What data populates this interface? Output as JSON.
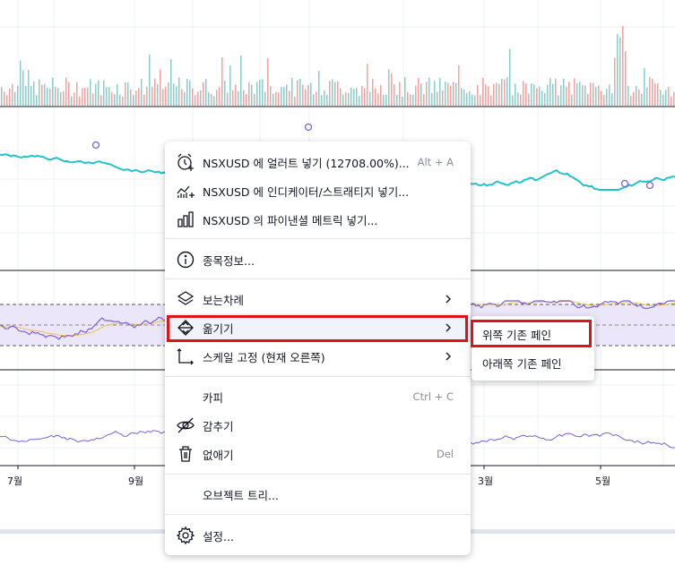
{
  "x_axis_labels": [
    "7월",
    "9월",
    "3월",
    "5월"
  ],
  "context_menu": {
    "items": [
      {
        "label": "NSXUSD 에 얼러트 넣기 (12708.00%)...",
        "shortcut": "Alt + A",
        "icon": "alarm-clock-icon"
      },
      {
        "label": "NSXUSD 에 인디케이터/스트래티지 넣기...",
        "icon": "indicator-add-icon"
      },
      {
        "label": "NSXUSD 의 파이낸셜 메트릭 넣기...",
        "icon": "bar-chart-icon"
      },
      {
        "label": "종목정보...",
        "icon": "info-icon"
      },
      {
        "label": "보는차례",
        "icon": "layers-icon",
        "has_submenu": true
      },
      {
        "label": "옮기기",
        "icon": "move-icon",
        "has_submenu": true,
        "active": true
      },
      {
        "label": "스케일 고정 (현재 오른쪽)",
        "icon": "scale-pin-icon",
        "has_submenu": true
      },
      {
        "label": "카피",
        "shortcut": "Ctrl + C"
      },
      {
        "label": "감추기",
        "icon": "eye-off-icon"
      },
      {
        "label": "없애기",
        "shortcut": "Del",
        "icon": "trash-icon"
      },
      {
        "label": "오브젝트 트리..."
      },
      {
        "label": "설정...",
        "icon": "gear-icon"
      }
    ]
  },
  "submenu": {
    "items": [
      {
        "label": "위쪽 기존 페인"
      },
      {
        "label": "아래쪽 기존 페인"
      }
    ]
  },
  "colors": {
    "line_series": "#22c4cc",
    "oscillator": "#7b61d8",
    "oscillator_ma": "#f2c14e",
    "volume_up": "#26a69a",
    "volume_down": "#ef5350",
    "highlight": "#e01418",
    "band_fill": "#ece6fb"
  }
}
